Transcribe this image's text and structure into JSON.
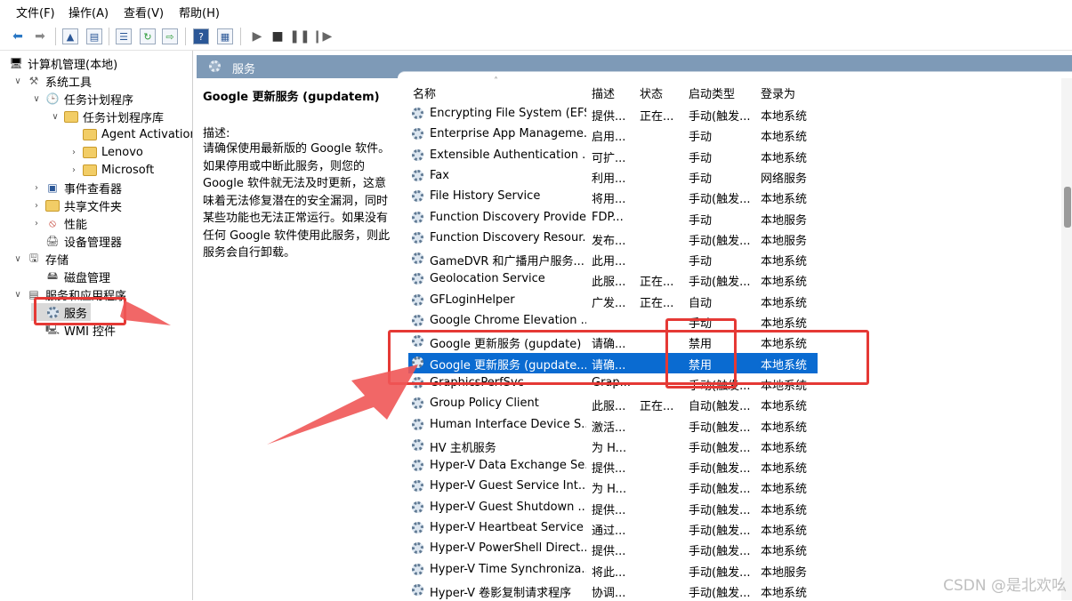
{
  "menu": [
    "文件(F)",
    "操作(A)",
    "查看(V)",
    "帮助(H)"
  ],
  "tree": {
    "root": "计算机管理(本地)",
    "system_tools": "系统工具",
    "task_scheduler": "任务计划程序",
    "task_scheduler_library": "任务计划程序库",
    "agent_activation": "Agent Activation",
    "lenovo": "Lenovo",
    "microsoft": "Microsoft",
    "event_viewer": "事件查看器",
    "shared_folders": "共享文件夹",
    "performance": "性能",
    "device_manager": "设备管理器",
    "storage": "存储",
    "disk_management": "磁盘管理",
    "services_apps": "服务和应用程序",
    "services": "服务",
    "wmi": "WMI 控件"
  },
  "panel_title": "服务",
  "description": {
    "title": "Google 更新服务 (gupdatem)",
    "label": "描述:",
    "lines": [
      "请确保使用最新版的 Google 软件。",
      "如果停用或中断此服务，则您的",
      "Google 软件就无法及时更新，这意",
      "味着无法修复潜在的安全漏洞，同时",
      "某些功能也无法正常运行。如果没有",
      "任何 Google 软件使用此服务，则此",
      "服务会自行卸载。"
    ]
  },
  "columns": {
    "name": "名称",
    "desc": "描述",
    "status": "状态",
    "startup": "启动类型",
    "logon": "登录为"
  },
  "services": [
    {
      "name": "Encrypting File System (EFS)",
      "desc": "提供...",
      "status": "正在...",
      "startup": "手动(触发...",
      "logon": "本地系统"
    },
    {
      "name": "Enterprise App Manageme...",
      "desc": "启用...",
      "status": "",
      "startup": "手动",
      "logon": "本地系统"
    },
    {
      "name": "Extensible Authentication ...",
      "desc": "可扩...",
      "status": "",
      "startup": "手动",
      "logon": "本地系统"
    },
    {
      "name": "Fax",
      "desc": "利用...",
      "status": "",
      "startup": "手动",
      "logon": "网络服务"
    },
    {
      "name": "File History Service",
      "desc": "将用...",
      "status": "",
      "startup": "手动(触发...",
      "logon": "本地系统"
    },
    {
      "name": "Function Discovery Provide...",
      "desc": "FDP...",
      "status": "",
      "startup": "手动",
      "logon": "本地服务"
    },
    {
      "name": "Function Discovery Resour...",
      "desc": "发布...",
      "status": "",
      "startup": "手动(触发...",
      "logon": "本地服务"
    },
    {
      "name": "GameDVR 和广播用户服务...",
      "desc": "此用...",
      "status": "",
      "startup": "手动",
      "logon": "本地系统"
    },
    {
      "name": "Geolocation Service",
      "desc": "此服...",
      "status": "正在...",
      "startup": "手动(触发...",
      "logon": "本地系统"
    },
    {
      "name": "GFLoginHelper",
      "desc": "广发...",
      "status": "正在...",
      "startup": "自动",
      "logon": "本地系统"
    },
    {
      "name": "Google Chrome Elevation ...",
      "desc": "",
      "status": "",
      "startup": "手动",
      "logon": "本地系统"
    },
    {
      "name": "Google 更新服务 (gupdate)",
      "desc": "请确...",
      "status": "",
      "startup": "禁用",
      "logon": "本地系统"
    },
    {
      "name": "Google 更新服务 (gupdate...",
      "desc": "请确...",
      "status": "",
      "startup": "禁用",
      "logon": "本地系统",
      "selected": true
    },
    {
      "name": "GraphicsPerfSvc",
      "desc": "Grap...",
      "status": "",
      "startup": "手动(触发...",
      "logon": "本地系统"
    },
    {
      "name": "Group Policy Client",
      "desc": "此服...",
      "status": "正在...",
      "startup": "自动(触发...",
      "logon": "本地系统"
    },
    {
      "name": "Human Interface Device S...",
      "desc": "激活...",
      "status": "",
      "startup": "手动(触发...",
      "logon": "本地系统"
    },
    {
      "name": "HV 主机服务",
      "desc": "为 H...",
      "status": "",
      "startup": "手动(触发...",
      "logon": "本地系统"
    },
    {
      "name": "Hyper-V Data Exchange Se...",
      "desc": "提供...",
      "status": "",
      "startup": "手动(触发...",
      "logon": "本地系统"
    },
    {
      "name": "Hyper-V Guest Service Int...",
      "desc": "为 H...",
      "status": "",
      "startup": "手动(触发...",
      "logon": "本地系统"
    },
    {
      "name": "Hyper-V Guest Shutdown ...",
      "desc": "提供...",
      "status": "",
      "startup": "手动(触发...",
      "logon": "本地系统"
    },
    {
      "name": "Hyper-V Heartbeat Service",
      "desc": "通过...",
      "status": "",
      "startup": "手动(触发...",
      "logon": "本地系统"
    },
    {
      "name": "Hyper-V PowerShell Direct...",
      "desc": "提供...",
      "status": "",
      "startup": "手动(触发...",
      "logon": "本地系统"
    },
    {
      "name": "Hyper-V Time Synchroniza...",
      "desc": "将此...",
      "status": "",
      "startup": "手动(触发...",
      "logon": "本地服务"
    },
    {
      "name": "Hyper-V 卷影复制请求程序",
      "desc": "协调...",
      "status": "",
      "startup": "手动(触发...",
      "logon": "本地系统"
    }
  ],
  "watermark": "CSDN @是北欢吆",
  "colors": {
    "selection": "#0a6bd1",
    "annotation": "#e53935",
    "panel_header": "#7e9ab7"
  }
}
